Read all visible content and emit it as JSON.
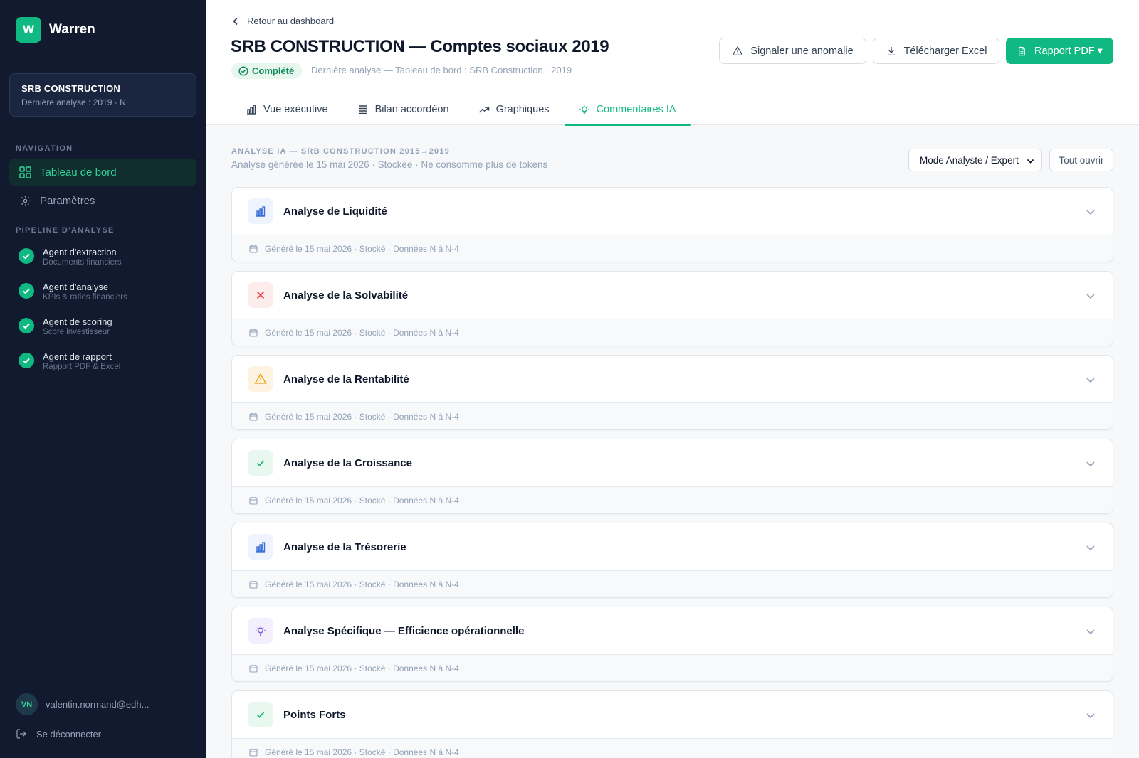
{
  "sidebar": {
    "brand_letter": "W",
    "brand_name": "Warren",
    "company": {
      "name": "SRB CONSTRUCTION",
      "subtitle": "Dernière analyse : 2019 · N"
    },
    "nav_label": "NAVIGATION",
    "nav": [
      {
        "label": "Tableau de bord",
        "icon": "grid-icon",
        "active": true
      },
      {
        "label": "Paramètres",
        "icon": "gear-icon",
        "active": false
      }
    ],
    "pipeline_label": "PIPELINE D'ANALYSE",
    "pipeline": [
      {
        "title": "Agent d'extraction",
        "subtitle": "Documents financiers"
      },
      {
        "title": "Agent d'analyse",
        "subtitle": "KPIs & ratios financiers"
      },
      {
        "title": "Agent de scoring",
        "subtitle": "Score investisseur"
      },
      {
        "title": "Agent de rapport",
        "subtitle": "Rapport PDF & Excel"
      }
    ],
    "user": {
      "initials": "VN",
      "email": "valentin.normand@edh..."
    },
    "logout_label": "Se déconnecter"
  },
  "header": {
    "back_label": "Retour au dashboard",
    "title": "SRB CONSTRUCTION — Comptes sociaux 2019",
    "status": "Complété",
    "last_analysis": "Dernière analyse — Tableau de bord : SRB Construction · 2019",
    "buttons": {
      "report_anomaly": "Signaler une anomalie",
      "download_excel": "Télécharger Excel",
      "pdf_report": "Rapport PDF ▾"
    },
    "tabs": [
      {
        "label": "Vue exécutive",
        "icon": "bar-chart-icon"
      },
      {
        "label": "Bilan accordéon",
        "icon": "list-icon"
      },
      {
        "label": "Graphiques",
        "icon": "trend-up-icon"
      },
      {
        "label": "Commentaires IA",
        "icon": "lightbulb-icon",
        "active": true
      }
    ]
  },
  "content": {
    "section_title": "ANALYSE IA — SRB CONSTRUCTION 2015→2019",
    "section_subtitle": "Analyse générée le 15 mai 2026 · Stockée · Ne consomme plus de tokens",
    "mode_select_value": "Mode Analyste / Expert",
    "open_all_label": "Tout ouvrir",
    "cards": [
      {
        "title": "Analyse de Liquidité",
        "icon": "bar-chart-icon",
        "tone": "blue",
        "meta": "Généré le 15 mai 2026 · Stocké · Données N à N-4"
      },
      {
        "title": "Analyse de la Solvabilité",
        "icon": "x-icon",
        "tone": "red",
        "meta": "Généré le 15 mai 2026 · Stocké · Données N à N-4"
      },
      {
        "title": "Analyse de la Rentabilité",
        "icon": "warning-icon",
        "tone": "amber",
        "meta": "Généré le 15 mai 2026 · Stocké · Données N à N-4"
      },
      {
        "title": "Analyse de la Croissance",
        "icon": "check-icon",
        "tone": "green",
        "meta": "Généré le 15 mai 2026 · Stocké · Données N à N-4"
      },
      {
        "title": "Analyse de la Trésorerie",
        "icon": "bar-chart-icon",
        "tone": "blue",
        "meta": "Généré le 15 mai 2026 · Stocké · Données N à N-4"
      },
      {
        "title": "Analyse Spécifique — Efficience opérationnelle",
        "icon": "lightbulb-icon",
        "tone": "purple",
        "meta": "Généré le 15 mai 2026 · Stocké · Données N à N-4"
      },
      {
        "title": "Points Forts",
        "icon": "check-icon",
        "tone": "green",
        "meta": "Généré le 15 mai 2026 · Stocké · Données N à N-4"
      }
    ]
  },
  "colors": {
    "accent": "#10b981",
    "sidebar_bg": "#111a2e",
    "danger": "#ef4444",
    "warning": "#f59e0b",
    "info": "#3b6fd8",
    "ai_purple": "#7c5cd6"
  }
}
